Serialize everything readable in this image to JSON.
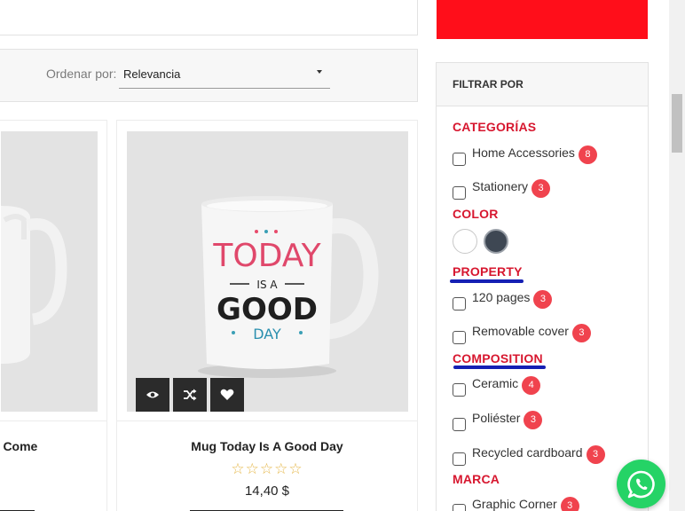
{
  "sort": {
    "label": "Ordenar por:",
    "value": "Relevancia"
  },
  "products": [
    {
      "title": "o Come"
    },
    {
      "title": "Mug Today Is A Good Day",
      "rating": "☆☆☆☆☆",
      "price": "14,40 $",
      "image_text": {
        "line1": "TODAY",
        "line2": "IS A",
        "line3": "GOOD",
        "line4": "DAY"
      }
    }
  ],
  "filter": {
    "header": "FILTRAR POR",
    "facets": [
      {
        "title": "CATEGORÍAS",
        "items": [
          {
            "label": "Home Accessories",
            "count": "8"
          },
          {
            "label": "Stationery",
            "count": "3"
          }
        ]
      },
      {
        "title": "COLOR",
        "swatches": [
          {
            "color": "#ffffff"
          },
          {
            "color": "#3e4753"
          }
        ]
      },
      {
        "title": "PROPERTY",
        "items": [
          {
            "label": "120 pages",
            "count": "3"
          },
          {
            "label": "Removable cover",
            "count": "3"
          }
        ]
      },
      {
        "title": "COMPOSITION",
        "items": [
          {
            "label": "Ceramic",
            "count": "4"
          },
          {
            "label": "Poliéster",
            "count": "3"
          },
          {
            "label": "Recycled cardboard",
            "count": "3"
          }
        ]
      },
      {
        "title": "MARCA",
        "items": [
          {
            "label": "Graphic Corner",
            "count": "3"
          }
        ]
      }
    ]
  },
  "colors": {
    "accent_red": "#d7172f",
    "banner_red": "#ff0e1a",
    "badge_red": "#f0434e",
    "whatsapp_green": "#25d366"
  }
}
